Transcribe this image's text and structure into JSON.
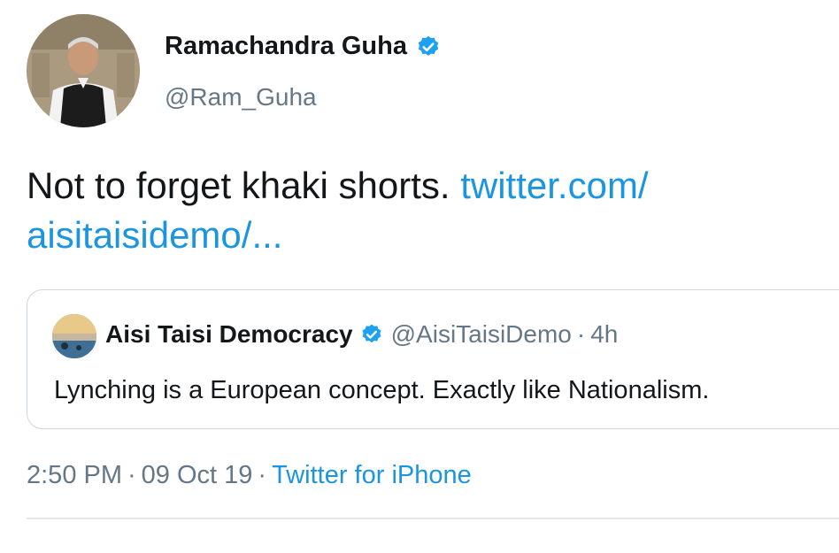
{
  "author": {
    "display_name": "Ramachandra Guha",
    "handle": "@Ram_Guha",
    "verified": true
  },
  "tweet": {
    "text": "Not to forget khaki shorts. ",
    "link_line1": "twitter.com/",
    "link_line2": "aisitaisidemo/..."
  },
  "quoted_tweet": {
    "display_name": "Aisi Taisi Democracy",
    "handle": "@AisiTaisiDemo",
    "separator": "·",
    "time": "4h",
    "text": "Lynching is a European concept. Exactly like Nationalism.",
    "verified": true
  },
  "meta": {
    "time": "2:50 PM",
    "separator": "·",
    "date": "09 Oct 19",
    "source": "Twitter for iPhone"
  },
  "colors": {
    "link": "#1b95e0",
    "secondary_text": "#657786",
    "primary_text": "#14171a",
    "border": "#ccd6dd"
  }
}
